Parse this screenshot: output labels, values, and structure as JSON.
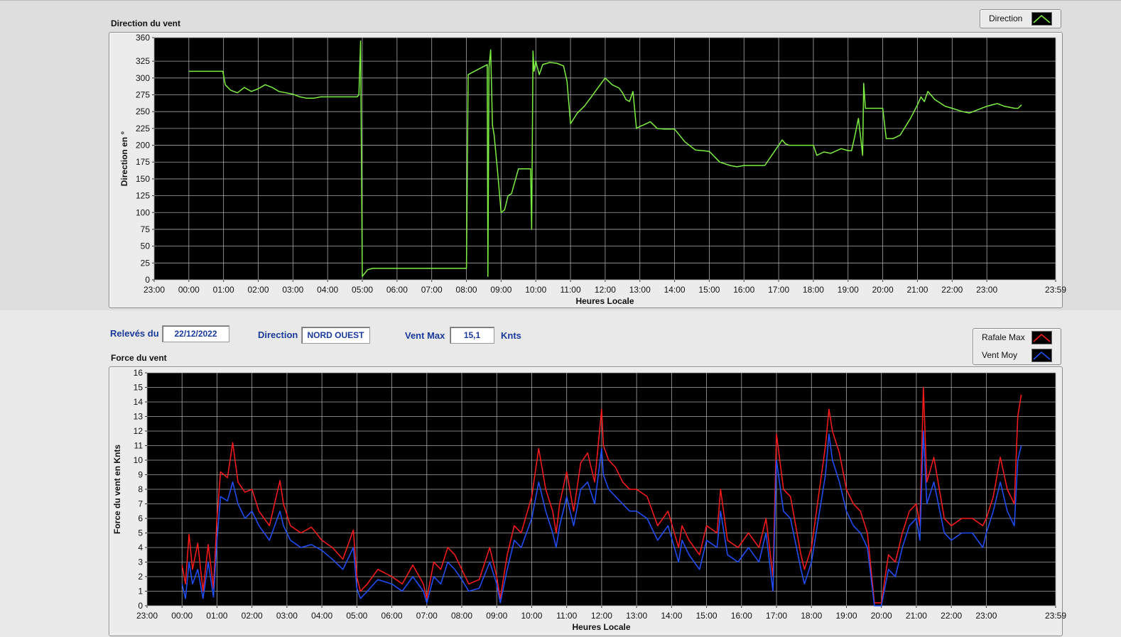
{
  "top_panel": {
    "title": "Direction du vent"
  },
  "bottom_panel": {
    "title": "Force du vent"
  },
  "info_bar": {
    "date_label": "Relevés du",
    "date_value": "22/12/2022",
    "direction_label": "Direction",
    "direction_value": "NORD OUEST",
    "vmax_label": "Vent Max",
    "vmax_value": "15,1",
    "vmax_unit": "Knts"
  },
  "legend_top": {
    "label": "Direction",
    "color": "#7cf040"
  },
  "legend_bottom": {
    "items": [
      {
        "label": "Rafale Max",
        "color": "#ff1a1a"
      },
      {
        "label": "Vent Moy",
        "color": "#1f4fff"
      }
    ]
  },
  "chart_data": [
    {
      "type": "line",
      "title": "Direction du vent",
      "xlabel": "Heures Locale",
      "ylabel": "Direction en °",
      "x_ticks": [
        "23:00",
        "00:00",
        "01:00",
        "02:00",
        "03:00",
        "04:00",
        "05:00",
        "06:00",
        "07:00",
        "08:00",
        "09:00",
        "10:00",
        "11:00",
        "12:00",
        "13:00",
        "14:00",
        "15:00",
        "16:00",
        "17:00",
        "18:00",
        "19:00",
        "20:00",
        "21:00",
        "22:00",
        "23:00",
        "23:59"
      ],
      "xlim_hours": [
        -1,
        24.983
      ],
      "ylim": [
        0,
        360
      ],
      "y_ticks": [
        0,
        25,
        50,
        75,
        100,
        125,
        150,
        175,
        200,
        225,
        250,
        275,
        300,
        325,
        360
      ],
      "grid": true,
      "legend_position": "top-right",
      "series": [
        {
          "name": "Direction",
          "color": "#7cf040",
          "x_hours": [
            0,
            0.98,
            1.05,
            1.2,
            1.4,
            1.6,
            1.8,
            2.0,
            2.2,
            2.4,
            2.6,
            2.8,
            3.0,
            3.2,
            3.4,
            3.6,
            3.8,
            4.0,
            4.5,
            4.85,
            4.9,
            4.95,
            5.0,
            5.15,
            5.3,
            6,
            7,
            7.5,
            8.0,
            8.05,
            8.6,
            8.62,
            8.65,
            8.7,
            8.75,
            8.8,
            8.9,
            9.0,
            9.1,
            9.2,
            9.3,
            9.5,
            9.85,
            9.88,
            9.92,
            9.95,
            10.0,
            10.1,
            10.2,
            10.4,
            10.6,
            10.8,
            10.9,
            11.0,
            11.2,
            11.4,
            11.6,
            11.8,
            12.0,
            12.2,
            12.4,
            12.5,
            12.6,
            12.7,
            12.8,
            12.9,
            13.0,
            13.1,
            13.3,
            13.5,
            13.7,
            14.0,
            14.3,
            14.6,
            14.8,
            15.0,
            15.3,
            15.6,
            15.8,
            16.0,
            16.3,
            16.6,
            16.8,
            17.0,
            17.1,
            17.2,
            17.3,
            17.5,
            18.0,
            18.1,
            18.3,
            18.5,
            18.8,
            19.0,
            19.1,
            19.2,
            19.3,
            19.4,
            19.42,
            19.45,
            19.5,
            19.8,
            20.0,
            20.1,
            20.3,
            20.5,
            20.8,
            21.0,
            21.1,
            21.2,
            21.3,
            21.5,
            21.8,
            22.0,
            22.3,
            22.5,
            22.7,
            23.0,
            23.3,
            23.5,
            23.8,
            23.9,
            24.0
          ],
          "values": [
            310,
            310,
            290,
            282,
            278,
            286,
            280,
            284,
            290,
            286,
            280,
            278,
            276,
            272,
            270,
            270,
            272,
            272,
            272,
            272,
            275,
            355,
            5,
            15,
            17,
            17,
            17,
            17,
            17,
            305,
            320,
            5,
            315,
            342,
            230,
            215,
            160,
            100,
            104,
            125,
            128,
            165,
            165,
            75,
            340,
            310,
            325,
            305,
            320,
            323,
            322,
            318,
            295,
            232,
            248,
            258,
            272,
            286,
            300,
            290,
            285,
            278,
            268,
            265,
            280,
            225,
            228,
            230,
            235,
            225,
            224,
            224,
            205,
            193,
            192,
            191,
            175,
            170,
            168,
            170,
            170,
            170,
            185,
            200,
            208,
            202,
            200,
            200,
            200,
            185,
            190,
            188,
            195,
            192,
            192,
            215,
            240,
            195,
            185,
            292,
            255,
            255,
            255,
            210,
            210,
            215,
            240,
            260,
            272,
            265,
            280,
            268,
            258,
            255,
            250,
            248,
            252,
            258,
            262,
            258,
            255,
            255,
            260,
            270,
            282
          ]
        }
      ]
    },
    {
      "type": "line",
      "title": "Force du vent",
      "xlabel": "Heures Locale",
      "ylabel": "Force du vent en Knts",
      "x_ticks": [
        "23:00",
        "00:00",
        "01:00",
        "02:00",
        "03:00",
        "04:00",
        "05:00",
        "06:00",
        "07:00",
        "08:00",
        "09:00",
        "10:00",
        "11:00",
        "12:00",
        "13:00",
        "14:00",
        "15:00",
        "16:00",
        "17:00",
        "18:00",
        "19:00",
        "20:00",
        "21:00",
        "22:00",
        "23:00",
        "23:59"
      ],
      "xlim_hours": [
        -1,
        24.983
      ],
      "ylim": [
        0,
        16
      ],
      "y_ticks": [
        0,
        1,
        2,
        3,
        4,
        5,
        6,
        7,
        8,
        9,
        10,
        11,
        12,
        13,
        14,
        15,
        16
      ],
      "grid": true,
      "legend_position": "top-right",
      "series": [
        {
          "name": "Rafale Max",
          "color": "#ff1a1a",
          "x_hours": [
            0,
            0.1,
            0.2,
            0.3,
            0.45,
            0.6,
            0.75,
            0.9,
            1.0,
            1.1,
            1.3,
            1.45,
            1.6,
            1.8,
            2.0,
            2.2,
            2.5,
            2.8,
            2.9,
            3.1,
            3.4,
            3.7,
            4.0,
            4.3,
            4.6,
            4.9,
            5.0,
            5.1,
            5.3,
            5.6,
            6.0,
            6.3,
            6.6,
            6.9,
            7.0,
            7.2,
            7.4,
            7.6,
            7.8,
            8.0,
            8.2,
            8.5,
            8.8,
            9.0,
            9.1,
            9.3,
            9.5,
            9.7,
            10.0,
            10.2,
            10.4,
            10.6,
            10.7,
            10.8,
            11.0,
            11.2,
            11.4,
            11.6,
            11.8,
            12.0,
            12.05,
            12.2,
            12.4,
            12.6,
            12.8,
            13.0,
            13.3,
            13.6,
            13.9,
            14.2,
            14.3,
            14.5,
            14.8,
            15.0,
            15.3,
            15.4,
            15.6,
            15.9,
            16.2,
            16.5,
            16.7,
            16.9,
            17.0,
            17.2,
            17.4,
            17.7,
            17.8,
            18.0,
            18.2,
            18.4,
            18.5,
            18.6,
            18.8,
            19.0,
            19.2,
            19.4,
            19.6,
            19.8,
            20.0,
            20.2,
            20.4,
            20.6,
            20.8,
            21.0,
            21.1,
            21.2,
            21.3,
            21.5,
            21.8,
            22.0,
            22.3,
            22.6,
            22.9,
            23.0,
            23.2,
            23.4,
            23.6,
            23.8,
            23.9,
            24.0
          ],
          "values": [
            2.8,
            1.5,
            4.9,
            2.5,
            4.3,
            1.0,
            4.2,
            1.2,
            6.0,
            9.2,
            8.8,
            11.2,
            8.5,
            7.8,
            8.0,
            6.5,
            5.5,
            8.6,
            7.0,
            5.5,
            5.0,
            5.4,
            4.5,
            4.0,
            3.2,
            5.2,
            2.0,
            1.0,
            1.5,
            2.5,
            2.0,
            1.5,
            2.8,
            1.5,
            0.5,
            3.0,
            2.5,
            4.0,
            3.5,
            2.5,
            1.5,
            1.8,
            4.0,
            2.0,
            0.5,
            3.5,
            5.5,
            5.0,
            7.5,
            10.8,
            8.0,
            6.5,
            5.0,
            7.0,
            9.2,
            6.5,
            9.8,
            10.5,
            8.5,
            13.5,
            11.0,
            10.0,
            9.5,
            8.5,
            8.0,
            8.0,
            7.5,
            5.5,
            6.5,
            4.0,
            5.5,
            4.5,
            3.5,
            5.5,
            5.0,
            8.0,
            4.5,
            4.0,
            5.0,
            4.0,
            6.0,
            2.0,
            11.8,
            8.0,
            7.5,
            3.5,
            2.5,
            4.0,
            7.5,
            11.0,
            13.5,
            12.0,
            10.5,
            8.0,
            7.0,
            6.5,
            5.0,
            0.2,
            0.2,
            3.5,
            3.0,
            5.0,
            6.5,
            7.0,
            5.5,
            15.0,
            8.5,
            10.2,
            6.0,
            5.5,
            6.0,
            6.0,
            5.5,
            6.0,
            7.5,
            10.2,
            8.0,
            7.0,
            13.0,
            14.5
          ]
        },
        {
          "name": "Vent Moy",
          "color": "#1f4fff",
          "x_hours": [
            0,
            0.1,
            0.2,
            0.3,
            0.45,
            0.6,
            0.75,
            0.9,
            1.0,
            1.1,
            1.3,
            1.45,
            1.6,
            1.8,
            2.0,
            2.2,
            2.5,
            2.8,
            2.9,
            3.1,
            3.4,
            3.7,
            4.0,
            4.3,
            4.6,
            4.9,
            5.0,
            5.1,
            5.3,
            5.6,
            6.0,
            6.3,
            6.6,
            6.9,
            7.0,
            7.2,
            7.4,
            7.6,
            7.8,
            8.0,
            8.2,
            8.5,
            8.8,
            9.0,
            9.1,
            9.3,
            9.5,
            9.7,
            10.0,
            10.2,
            10.4,
            10.6,
            10.7,
            10.8,
            11.0,
            11.2,
            11.4,
            11.6,
            11.8,
            12.0,
            12.05,
            12.2,
            12.4,
            12.6,
            12.8,
            13.0,
            13.3,
            13.6,
            13.9,
            14.2,
            14.3,
            14.5,
            14.8,
            15.0,
            15.3,
            15.4,
            15.6,
            15.9,
            16.2,
            16.5,
            16.7,
            16.9,
            17.0,
            17.2,
            17.4,
            17.7,
            17.8,
            18.0,
            18.2,
            18.4,
            18.5,
            18.6,
            18.8,
            19.0,
            19.2,
            19.4,
            19.6,
            19.8,
            20.0,
            20.2,
            20.4,
            20.6,
            20.8,
            21.0,
            21.1,
            21.2,
            21.3,
            21.5,
            21.8,
            22.0,
            22.3,
            22.6,
            22.9,
            23.0,
            23.2,
            23.4,
            23.6,
            23.8,
            23.9,
            24.0
          ],
          "values": [
            1.5,
            0.5,
            3.0,
            1.5,
            2.5,
            0.5,
            3.0,
            0.6,
            4.5,
            7.5,
            7.2,
            8.5,
            7.0,
            6.0,
            6.5,
            5.5,
            4.5,
            6.5,
            5.5,
            4.5,
            4.0,
            4.2,
            3.8,
            3.2,
            2.5,
            4.0,
            1.2,
            0.5,
            1.0,
            1.8,
            1.5,
            1.0,
            2.0,
            1.0,
            0.2,
            2.0,
            1.5,
            3.0,
            2.5,
            1.8,
            1.0,
            1.2,
            3.0,
            1.5,
            0.2,
            2.5,
            4.5,
            4.0,
            6.0,
            8.5,
            6.5,
            5.0,
            4.0,
            5.5,
            7.5,
            5.5,
            8.0,
            8.5,
            7.0,
            10.8,
            9.0,
            8.0,
            7.5,
            7.0,
            6.5,
            6.5,
            6.0,
            4.5,
            5.5,
            3.0,
            4.5,
            3.5,
            2.5,
            4.5,
            4.0,
            6.5,
            3.5,
            3.0,
            4.0,
            3.0,
            5.0,
            1.0,
            10.0,
            6.5,
            6.0,
            2.5,
            1.5,
            3.0,
            6.0,
            9.0,
            11.8,
            10.0,
            8.5,
            6.5,
            5.5,
            5.0,
            4.0,
            0.0,
            0.0,
            2.5,
            2.0,
            4.0,
            5.5,
            6.0,
            4.5,
            12.0,
            7.0,
            8.5,
            5.0,
            4.5,
            5.0,
            5.0,
            4.0,
            5.0,
            6.5,
            8.5,
            6.5,
            5.5,
            10.0,
            11.0
          ]
        }
      ]
    }
  ]
}
